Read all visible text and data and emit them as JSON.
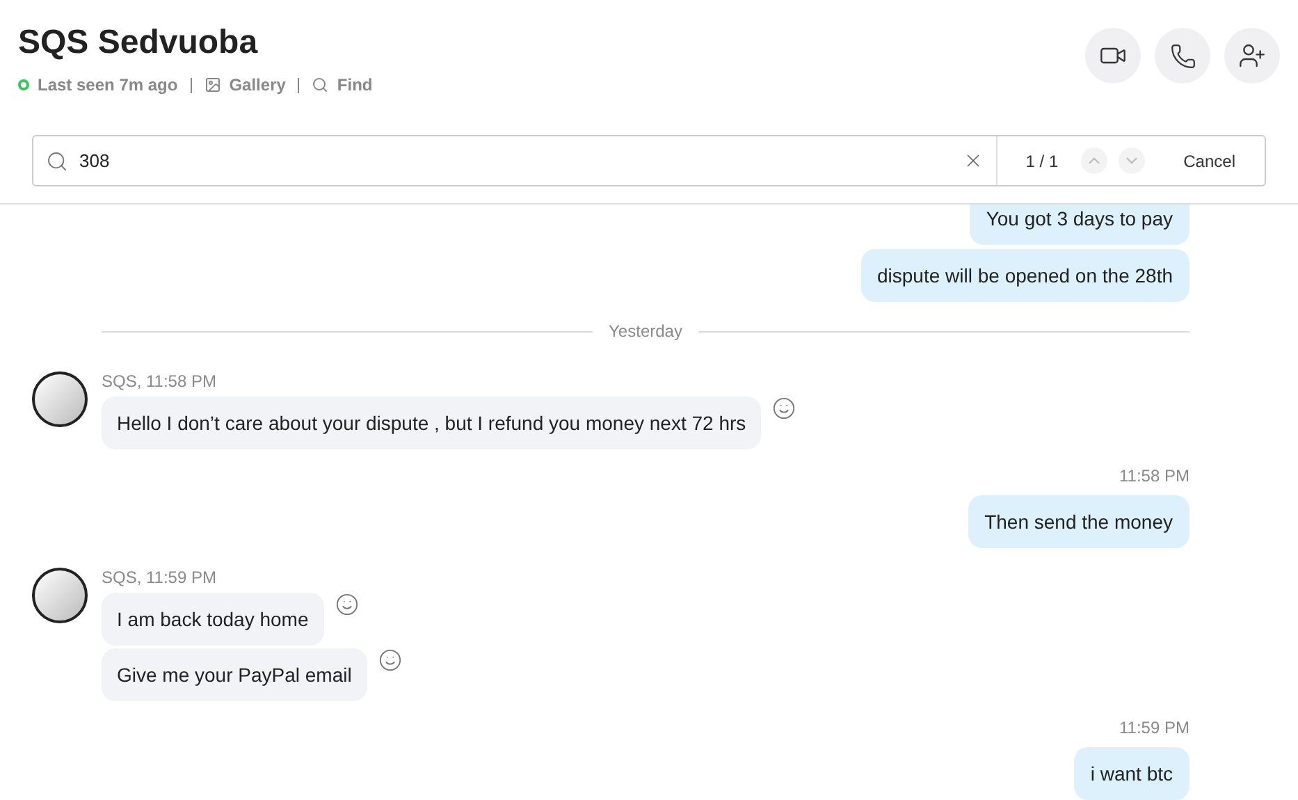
{
  "header": {
    "title": "SQS Sedvuoba",
    "status": "Last seen 7m ago",
    "online": true,
    "links": [
      "Gallery",
      "Find"
    ]
  },
  "search": {
    "value": "308",
    "counter": "1 / 1",
    "cancel": "Cancel"
  },
  "messages": [
    {
      "kind": "outgoing",
      "texts": [
        "You got 3 days to pay",
        "dispute will be opened on the 28th"
      ]
    },
    {
      "kind": "divider",
      "text": "Yesterday"
    },
    {
      "kind": "incoming",
      "meta": "SQS, 11:58 PM",
      "texts": [
        "Hello I don’t care about your dispute , but I refund you money next 72 hrs"
      ]
    },
    {
      "kind": "outgoing",
      "time": "11:58 PM",
      "texts": [
        "Then send the money"
      ]
    },
    {
      "kind": "incoming",
      "meta": "SQS, 11:59 PM",
      "texts": [
        "I am back today home",
        "Give me your PayPal email"
      ]
    },
    {
      "kind": "outgoing",
      "time": "11:59 PM",
      "texts": [
        "i want btc"
      ]
    }
  ]
}
